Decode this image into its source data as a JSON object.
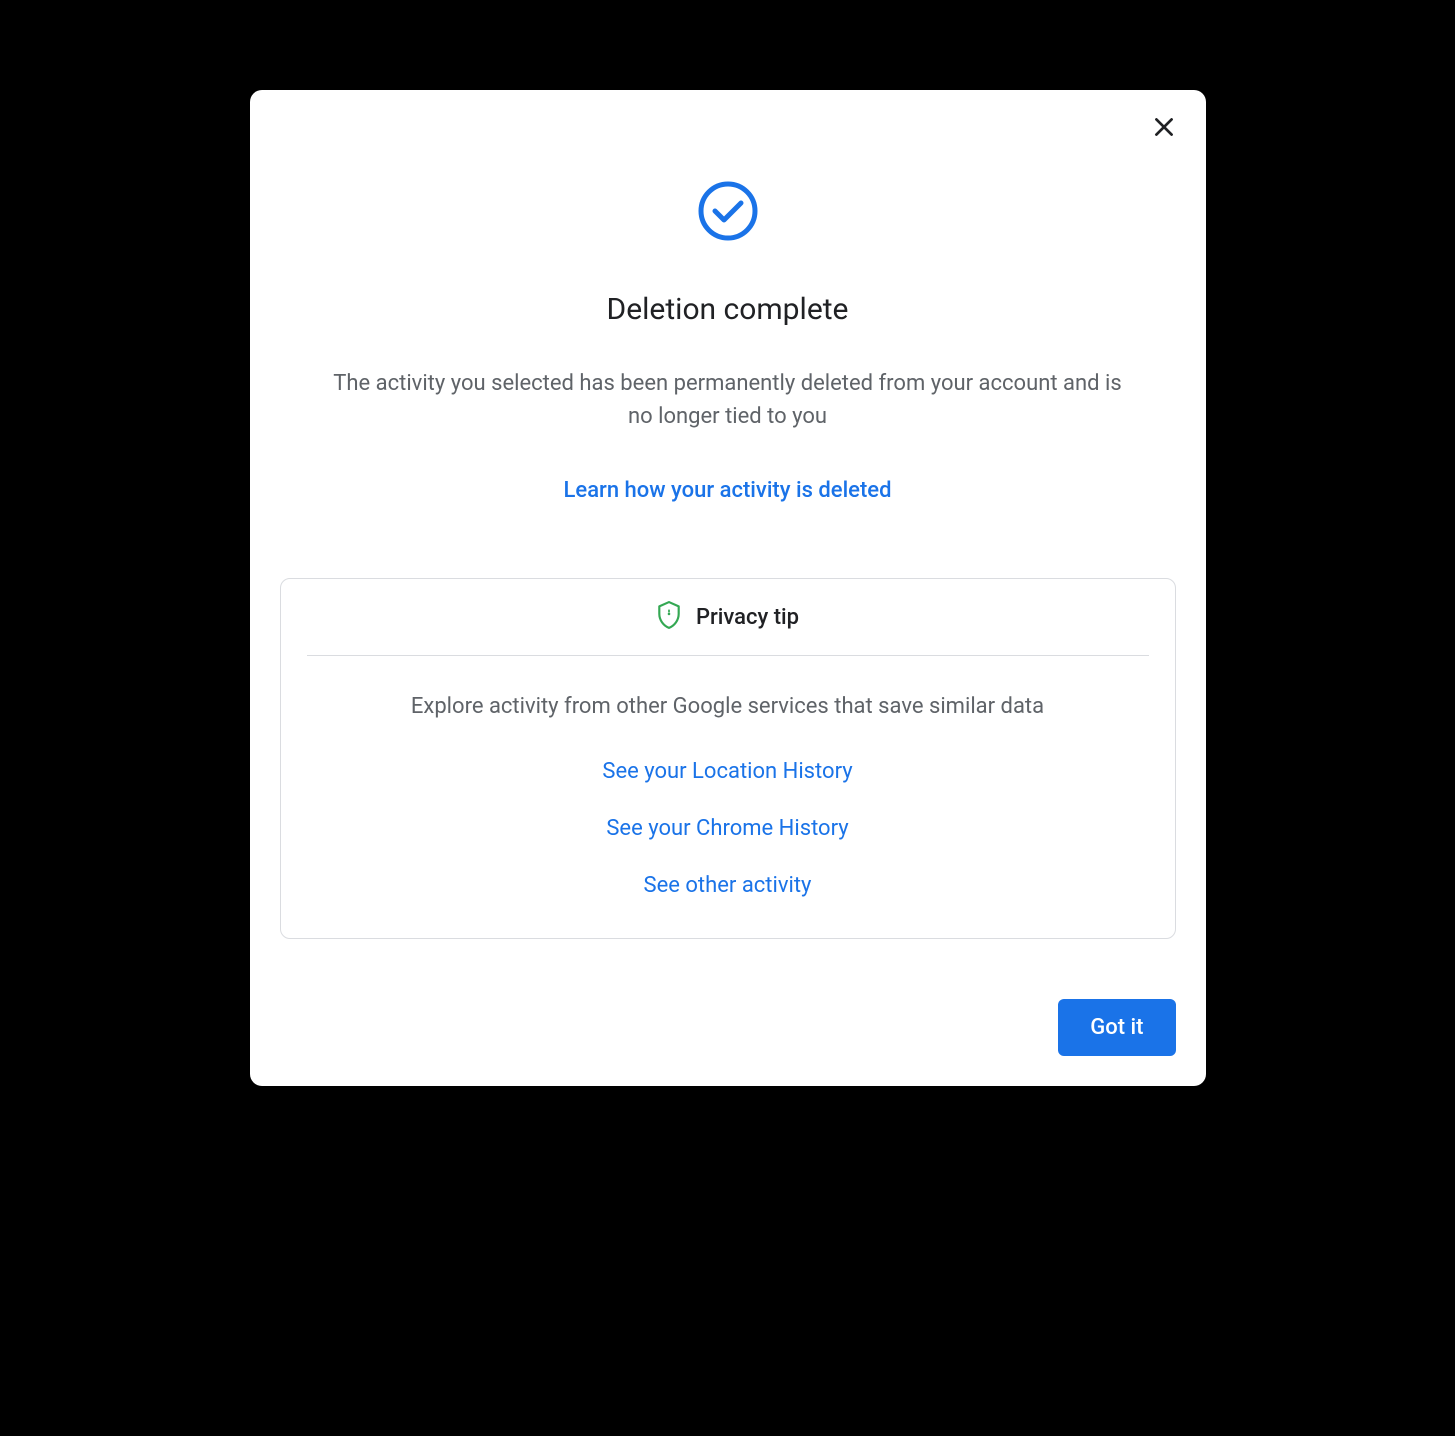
{
  "dialog": {
    "title": "Deletion complete",
    "description": "The activity you selected has been permanently deleted from your account and is no longer tied to you",
    "learn_link": "Learn how your activity is deleted"
  },
  "tip": {
    "title": "Privacy tip",
    "description": "Explore activity from other Google services that save similar data",
    "links": [
      "See your Location History",
      "See your Chrome History",
      "See other activity"
    ]
  },
  "footer": {
    "confirm_button": "Got it"
  }
}
